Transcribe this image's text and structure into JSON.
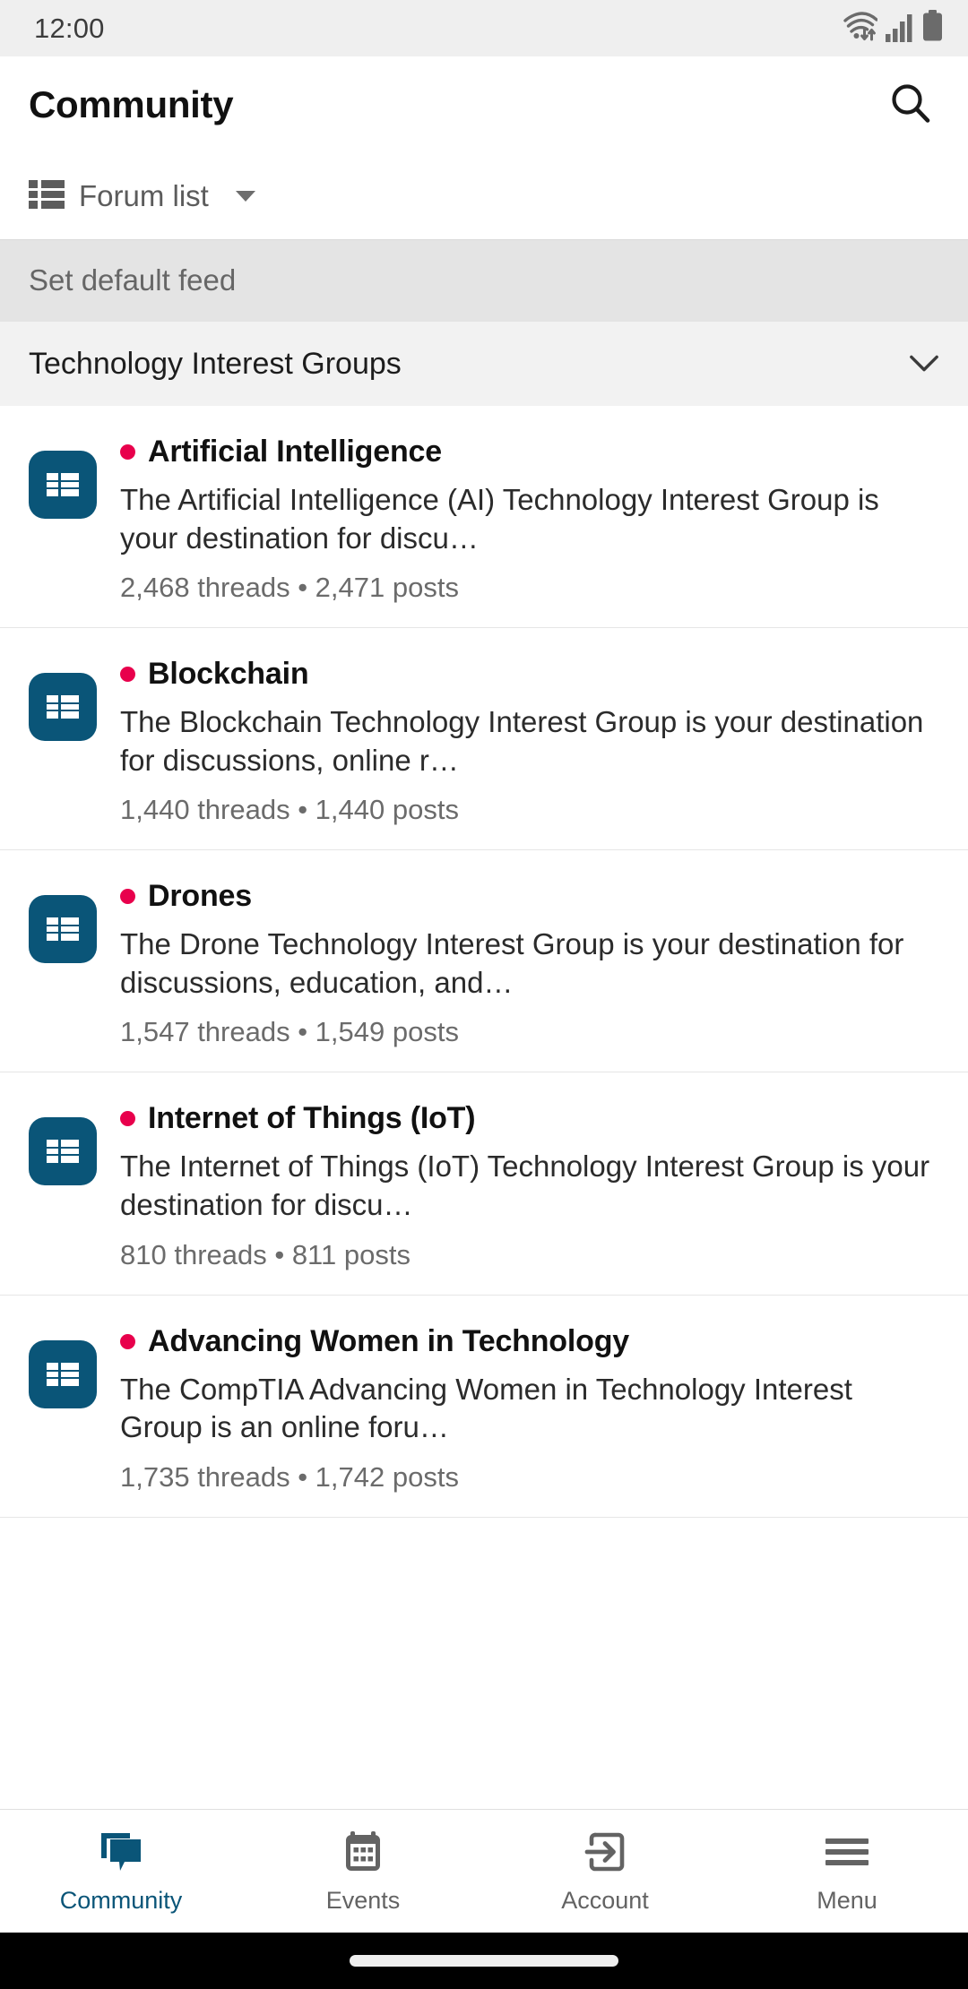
{
  "status_bar": {
    "time": "12:00",
    "icons": [
      "wifi-icon",
      "cellular-signal-icon",
      "battery-icon"
    ]
  },
  "header": {
    "title": "Community",
    "search_icon": "search-icon",
    "forum_selector": {
      "icon": "list-icon",
      "label": "Forum list",
      "caret": "caret-down-icon"
    }
  },
  "default_feed": {
    "label": "Set default feed"
  },
  "section": {
    "title": "Technology Interest Groups",
    "chevron": "chevron-down-icon"
  },
  "colors": {
    "icon_tile": "#0a5578",
    "unread_dot": "#e8004c",
    "accent": "#0a5578",
    "statusbar_bg": "#efefef",
    "default_feed_bg": "#e4e4e4",
    "section_bg": "#f2f2f2",
    "nav_inactive": "#636363"
  },
  "forums": [
    {
      "icon": "forum-tile-icon",
      "unread": true,
      "title": "Artificial Intelligence",
      "description": "The Artificial Intelligence (AI) Technology Interest Group is your destination for discu…",
      "meta": "2,468 threads • 2,471 posts",
      "threads": "2,468",
      "posts": "2,471"
    },
    {
      "icon": "forum-tile-icon",
      "unread": true,
      "title": "Blockchain",
      "description": "The Blockchain Technology Interest Group is your destination for discussions, online r…",
      "meta": "1,440 threads • 1,440 posts",
      "threads": "1,440",
      "posts": "1,440"
    },
    {
      "icon": "forum-tile-icon",
      "unread": true,
      "title": "Drones",
      "description": "The Drone Technology Interest Group is your destination for discussions, education, and…",
      "meta": "1,547 threads • 1,549 posts",
      "threads": "1,547",
      "posts": "1,549"
    },
    {
      "icon": "forum-tile-icon",
      "unread": true,
      "title": "Internet of Things (IoT)",
      "description": "The Internet of Things (IoT) Technology Interest Group is your destination for discu…",
      "meta": "810 threads • 811 posts",
      "threads": "810",
      "posts": "811"
    },
    {
      "icon": "forum-tile-icon",
      "unread": true,
      "title": "Advancing Women in Technology",
      "description": "The CompTIA Advancing Women in Technology Interest Group is an online foru…",
      "meta": "1,735 threads • 1,742 posts",
      "threads": "1,735",
      "posts": "1,742"
    }
  ],
  "bottom_nav": {
    "items": [
      {
        "label": "Community",
        "icon": "chat-bubbles-icon",
        "active": true
      },
      {
        "label": "Events",
        "icon": "calendar-icon",
        "active": false
      },
      {
        "label": "Account",
        "icon": "sign-in-icon",
        "active": false
      },
      {
        "label": "Menu",
        "icon": "hamburger-menu-icon",
        "active": false
      }
    ]
  }
}
